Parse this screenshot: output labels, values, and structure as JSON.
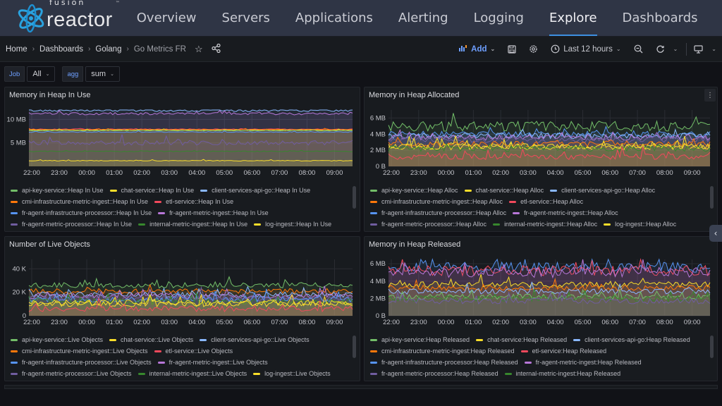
{
  "app": {
    "logo": {
      "line1": "fusion",
      "line2": "reactor",
      "tm": "™"
    },
    "nav": [
      {
        "label": "Overview",
        "active": false
      },
      {
        "label": "Servers",
        "active": false
      },
      {
        "label": "Applications",
        "active": false
      },
      {
        "label": "Alerting",
        "active": false
      },
      {
        "label": "Logging",
        "active": false
      },
      {
        "label": "Explore",
        "active": true
      },
      {
        "label": "Dashboards",
        "active": false
      }
    ],
    "accent": "#3d8fe0"
  },
  "toolbar": {
    "breadcrumb": [
      "Home",
      "Dashboards",
      "Golang",
      "Go Metrics FR"
    ],
    "star_icon": "star-icon",
    "share_icon": "share-icon",
    "add_label": "Add",
    "time_range": "Last 12 hours"
  },
  "variables": [
    {
      "label": "Job",
      "value": "All"
    },
    {
      "label": "agg",
      "value": "sum"
    }
  ],
  "legend_colors": {
    "api-key-service": "#73bf69",
    "chat-service": "#fade2a",
    "client-services-api-go": "#8ab8ff",
    "cmi-infrastructure-metric-ingest": "#ff780a",
    "etl-service": "#f2495c",
    "fr-agent-infrastructure-processor": "#5794f2",
    "fr-agent-metric-ingest": "#b877d9",
    "fr-agent-metric-processor": "#705da0",
    "internal-metric-ingest": "#37872d",
    "log-ingest": "#fade2a"
  },
  "chart_data": [
    {
      "type": "line",
      "title": "Memory in Heap In Use",
      "x": [
        "22:00",
        "23:00",
        "00:00",
        "01:00",
        "02:00",
        "03:00",
        "04:00",
        "05:00",
        "06:00",
        "07:00",
        "08:00",
        "09:00"
      ],
      "yticks": [
        "5 MB",
        "10 MB"
      ],
      "ylim": [
        0,
        12
      ],
      "yunit": "MB",
      "series": [
        {
          "name": "api-key-service::Heap In Use",
          "level": 7.6
        },
        {
          "name": "chat-service::Heap In Use",
          "level": 7.7
        },
        {
          "name": "client-services-api-go::Heap In Use",
          "level": 11.9
        },
        {
          "name": "cmi-infrastructure-metric-ingest::Heap In Use",
          "level": 7.8
        },
        {
          "name": "etl-service::Heap In Use",
          "level": 7.9
        },
        {
          "name": "fr-agent-infrastructure-processor::Heap In Use",
          "level": 7.3
        },
        {
          "name": "fr-agent-metric-ingest::Heap In Use",
          "level": 11.2
        },
        {
          "name": "fr-agent-metric-processor::Heap In Use",
          "level": 5.0
        },
        {
          "name": "internal-metric-ingest::Heap In Use",
          "level": 3.2
        },
        {
          "name": "log-ingest::Heap In Use",
          "level": 1.2
        }
      ]
    },
    {
      "type": "line",
      "title": "Memory in Heap Allocated",
      "x": [
        "22:00",
        "23:00",
        "00:00",
        "01:00",
        "02:00",
        "03:00",
        "04:00",
        "05:00",
        "06:00",
        "07:00",
        "08:00",
        "09:00"
      ],
      "yticks": [
        "0 B",
        "2 MB",
        "4 MB",
        "6 MB"
      ],
      "ylim": [
        0,
        7
      ],
      "yunit": "MB",
      "series": [
        {
          "name": "api-key-service::Heap Alloc",
          "level": 5.0
        },
        {
          "name": "chat-service::Heap Alloc",
          "level": 2.4
        },
        {
          "name": "client-services-api-go::Heap Alloc",
          "level": 3.8
        },
        {
          "name": "cmi-infrastructure-metric-ingest::Heap Alloc",
          "level": 2.8
        },
        {
          "name": "etl-service::Heap Alloc",
          "level": 1.2
        },
        {
          "name": "fr-agent-infrastructure-processor::Heap Alloc",
          "level": 4.0
        },
        {
          "name": "fr-agent-metric-ingest::Heap Alloc",
          "level": 3.6
        },
        {
          "name": "fr-agent-metric-processor::Heap Alloc",
          "level": 3.3
        },
        {
          "name": "internal-metric-ingest::Heap Alloc",
          "level": 2.2
        },
        {
          "name": "log-ingest::Heap Alloc",
          "level": 2.5
        }
      ]
    },
    {
      "type": "line",
      "title": "Number of Live Objects",
      "x": [
        "22:00",
        "23:00",
        "00:00",
        "01:00",
        "02:00",
        "03:00",
        "04:00",
        "05:00",
        "06:00",
        "07:00",
        "08:00",
        "09:00"
      ],
      "yticks": [
        "0",
        "20 K",
        "40 K"
      ],
      "ylim": [
        0,
        48
      ],
      "yunit": "K",
      "series": [
        {
          "name": "api-key-service::Live Objects",
          "level": 26
        },
        {
          "name": "chat-service::Live Objects",
          "level": 10
        },
        {
          "name": "client-services-api-go::Live Objects",
          "level": 18
        },
        {
          "name": "cmi-infrastructure-metric-ingest::Live Objects",
          "level": 21
        },
        {
          "name": "etl-service::Live Objects",
          "level": 6
        },
        {
          "name": "fr-agent-infrastructure-processor::Live Objects",
          "level": 14
        },
        {
          "name": "fr-agent-metric-ingest::Live Objects",
          "level": 17
        },
        {
          "name": "fr-agent-metric-processor::Live Objects",
          "level": 15
        },
        {
          "name": "internal-metric-ingest::Live Objects",
          "level": 12
        },
        {
          "name": "log-ingest::Live Objects",
          "level": 11
        }
      ]
    },
    {
      "type": "line",
      "title": "Memory in Heap Released",
      "x": [
        "22:00",
        "23:00",
        "00:00",
        "01:00",
        "02:00",
        "03:00",
        "04:00",
        "05:00",
        "06:00",
        "07:00",
        "08:00",
        "09:00"
      ],
      "yticks": [
        "0 B",
        "2 MB",
        "4 MB",
        "6 MB"
      ],
      "ylim": [
        0,
        6.5
      ],
      "yunit": "MB",
      "series": [
        {
          "name": "api-key-service:Heap Released",
          "level": 2.2
        },
        {
          "name": "chat-service:Heap Released",
          "level": 3.6
        },
        {
          "name": "client-services-api-go:Heap Released",
          "level": 2.8
        },
        {
          "name": "cmi-infrastructure-metric-ingest:Heap Released",
          "level": 3.2
        },
        {
          "name": "etl-service:Heap Released",
          "level": 5.2
        },
        {
          "name": "fr-agent-infrastructure-processor:Heap Released",
          "level": 5.6
        },
        {
          "name": "fr-agent-metric-ingest:Heap Released",
          "level": 5.0
        },
        {
          "name": "fr-agent-metric-processor:Heap Released",
          "level": 1.7
        },
        {
          "name": "internal-metric-ingest:Heap Released",
          "level": 2.0
        }
      ]
    }
  ]
}
